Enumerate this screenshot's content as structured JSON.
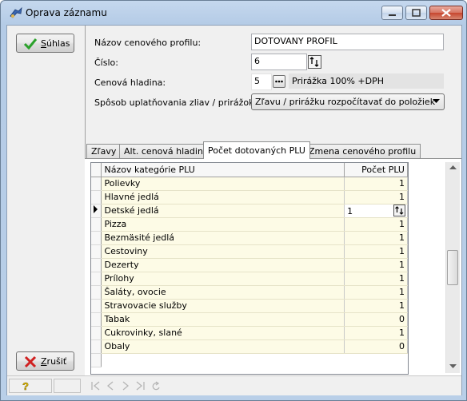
{
  "window": {
    "title": "Oprava záznamu"
  },
  "buttons": {
    "confirm": "Súhlas",
    "cancel": "Zrušiť"
  },
  "form": {
    "name_label": "Názov cenového profilu:",
    "name_value": "DOTOVANY PROFIL",
    "number_label": "Číslo:",
    "number_value": "6",
    "price_level_label": "Cenová hladina:",
    "price_level_value": "5",
    "price_level_desc": "Prirážka 100% +DPH",
    "discount_label": "Spôsob uplatňovania zliav / prirážok:",
    "discount_value": "Zľavu / prirážku rozpočítavať do položiek"
  },
  "tabs": [
    "Zľavy",
    "Alt. cenová hladina",
    "Počet dotovaných PLU",
    "Zmena cenového profilu"
  ],
  "active_tab": "Počet dotovaných PLU",
  "grid": {
    "columns": [
      "Názov kategórie PLU",
      "Počet PLU"
    ],
    "rows": [
      {
        "name": "Polievky",
        "count": "1"
      },
      {
        "name": "Hlavné jedlá",
        "count": "1"
      },
      {
        "name": "Detské jedlá",
        "count": "1"
      },
      {
        "name": "Pizza",
        "count": "1"
      },
      {
        "name": "Bezmäsité jedlá",
        "count": "1"
      },
      {
        "name": "Cestoviny",
        "count": "1"
      },
      {
        "name": "Dezerty",
        "count": "1"
      },
      {
        "name": "Prílohy",
        "count": "1"
      },
      {
        "name": "Šaláty, ovocie",
        "count": "1"
      },
      {
        "name": "Stravovacie služby",
        "count": "1"
      },
      {
        "name": "Tabak",
        "count": "0"
      },
      {
        "name": "Cukrovinky, slané",
        "count": "1"
      },
      {
        "name": "Obaly",
        "count": "0"
      }
    ],
    "current_row": 2
  },
  "colors": {
    "grid_cell_bg": "#fdfbe6",
    "confirm_check": "#2aa12a",
    "cancel_x": "#d02020"
  }
}
